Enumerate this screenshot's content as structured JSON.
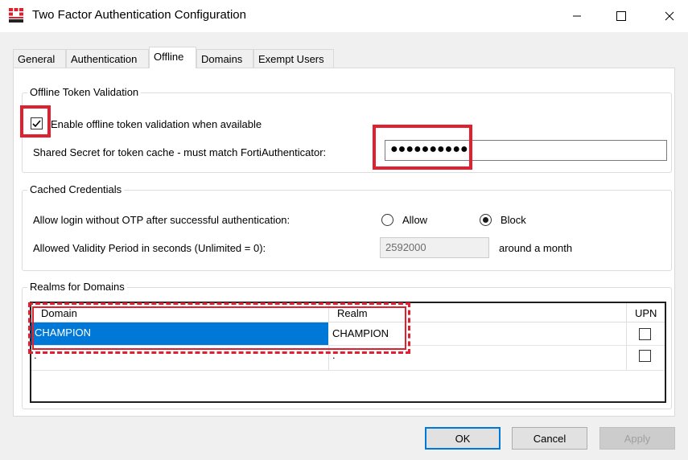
{
  "window": {
    "title": "Two Factor Authentication Configuration"
  },
  "tabs": [
    {
      "label": "General"
    },
    {
      "label": "Authentication"
    },
    {
      "label": "Offline"
    },
    {
      "label": "Domains"
    },
    {
      "label": "Exempt Users"
    }
  ],
  "offline_group": {
    "title": "Offline Token Validation",
    "enable_label": "Enable offline token validation when available",
    "enable_checked": true,
    "secret_label": "Shared Secret for token cache - must match FortiAuthenticator:",
    "secret_value": "●●●●●●●●●●"
  },
  "cached_group": {
    "title": "Cached Credentials",
    "login_label": "Allow login without OTP after successful authentication:",
    "allow_label": "Allow",
    "block_label": "Block",
    "selected": "Block",
    "validity_label": "Allowed Validity Period in seconds (Unlimited = 0):",
    "validity_value": "2592000",
    "validity_hint": "around a month"
  },
  "realms_group": {
    "title": "Realms for Domains",
    "columns": {
      "domain": "Domain",
      "realm": "Realm",
      "upn": "UPN"
    },
    "rows": [
      {
        "domain": "CHAMPION",
        "realm": "CHAMPION",
        "upn": false
      },
      {
        "domain": ".",
        "realm": ".",
        "upn": false
      }
    ]
  },
  "buttons": {
    "ok": "OK",
    "cancel": "Cancel",
    "apply": "Apply"
  },
  "colors": {
    "accent": "#0078d7",
    "highlight": "#e0202e"
  }
}
